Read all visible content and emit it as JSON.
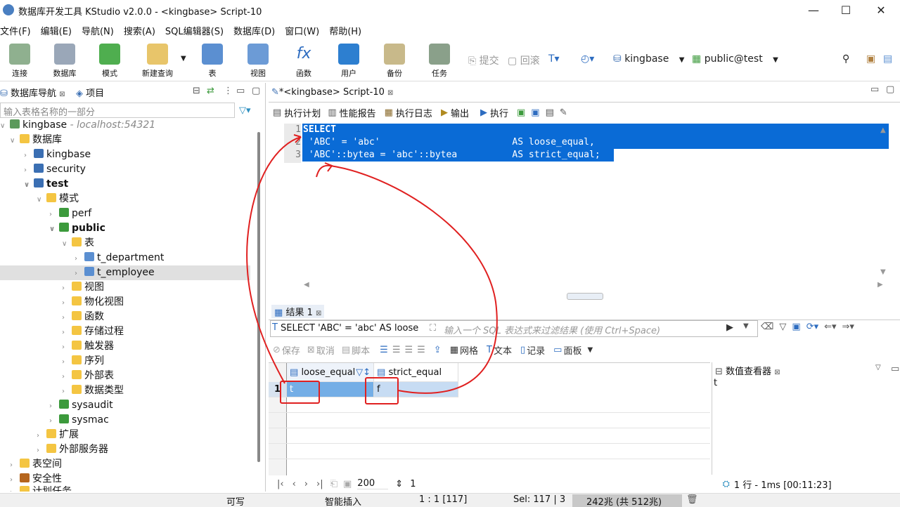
{
  "window": {
    "title": "数据库开发工具 KStudio v2.0.0 - <kingbase> Script-10"
  },
  "menu": [
    "文件(F)",
    "编辑(E)",
    "导航(N)",
    "搜索(A)",
    "SQL编辑器(S)",
    "数据库(D)",
    "窗口(W)",
    "帮助(H)"
  ],
  "toolbar": {
    "buttons": [
      "连接",
      "数据库",
      "模式",
      "新建查询",
      "表",
      "视图",
      "函数",
      "用户",
      "备份",
      "任务"
    ],
    "commit": "提交",
    "rollback": "回滚",
    "connection": "kingbase",
    "schema": "public@test"
  },
  "left_panel": {
    "tab_navigator": "数据库导航",
    "tab_project": "项目",
    "filter_placeholder": "输入表格名称的一部分",
    "tree": {
      "conn": "kingbase",
      "conn_host": "- localhost:54321",
      "databases": "数据库",
      "db_kingbase": "kingbase",
      "db_security": "security",
      "db_test": "test",
      "schemas": "模式",
      "schema_perf": "perf",
      "schema_public": "public",
      "tables": "表",
      "t_department": "t_department",
      "t_employee": "t_employee",
      "views": "视图",
      "mviews": "物化视图",
      "functions": "函数",
      "procedures": "存储过程",
      "triggers": "触发器",
      "sequences": "序列",
      "foreign_tables": "外部表",
      "data_types": "数据类型",
      "sysaudit": "sysaudit",
      "sysmac": "sysmac",
      "extensions": "扩展",
      "foreign_servers": "外部服务器",
      "tablespaces": "表空间",
      "security": "安全性",
      "scheduled_tasks": "计划任务"
    }
  },
  "editor": {
    "tab": "*<kingbase> Script-10",
    "toolbar": [
      "执行计划",
      "性能报告",
      "执行日志",
      "输出",
      "执行"
    ],
    "lines": [
      {
        "num": "1",
        "text": "SELECT"
      },
      {
        "num": "2",
        "text": " 'ABC' = 'abc'                        AS loose_equal,"
      },
      {
        "num": "3",
        "text": " 'ABC'::bytea = 'abc'::bytea          AS strict_equal;"
      }
    ]
  },
  "results": {
    "tab": "结果 1",
    "filter_query": "SELECT 'ABC' = 'abc' AS loose",
    "filter_placeholder": "输入一个 SQL 表达式来过滤结果 (使用 Ctrl+Space)",
    "actions": [
      "保存",
      "取消",
      "脚本",
      "网格",
      "文本",
      "记录",
      "面板"
    ],
    "columns": [
      "loose_equal",
      "strict_equal"
    ],
    "rows": [
      {
        "num": "1",
        "cells": [
          "t",
          "f"
        ]
      }
    ],
    "viewer_title": "数值查看器",
    "viewer_value": "t",
    "page_size": "200",
    "page_count": "1",
    "summary": "1 行 - 1ms [00:11:23]"
  },
  "status": {
    "mode": "可写",
    "insert": "智能插入",
    "position": "1 : 1 [117]",
    "sel": "Sel: 117 | 3",
    "memory": "242兆 (共 512兆)"
  },
  "colors": {
    "selection": "#0a6bd6",
    "annotation": "#e02020"
  }
}
